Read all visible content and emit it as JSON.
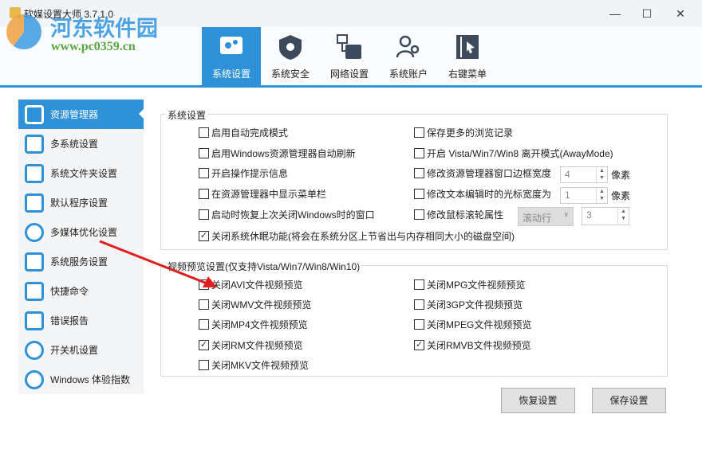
{
  "window": {
    "title": "软媒设置大师 3.7.1.0",
    "minimize": "—",
    "maximize": "☐",
    "close": "✕"
  },
  "watermark": {
    "line1": "河东软件园",
    "line2": "www.pc0359.cn"
  },
  "tabs": [
    {
      "label": "系统设置",
      "icon": "gear-monitor-icon",
      "active": true
    },
    {
      "label": "系统安全",
      "icon": "shield-gear-icon"
    },
    {
      "label": "网络设置",
      "icon": "network-icon"
    },
    {
      "label": "系统账户",
      "icon": "users-icon"
    },
    {
      "label": "右键菜单",
      "icon": "cursor-menu-icon"
    }
  ],
  "sidebar": [
    {
      "label": "资源管理器",
      "active": true
    },
    {
      "label": "多系统设置"
    },
    {
      "label": "系统文件夹设置"
    },
    {
      "label": "默认程序设置"
    },
    {
      "label": "多媒体优化设置"
    },
    {
      "label": "系统服务设置"
    },
    {
      "label": "快捷命令"
    },
    {
      "label": "错误报告"
    },
    {
      "label": "开关机设置"
    },
    {
      "label": "Windows 体验指数"
    }
  ],
  "system": {
    "title": "系统设置",
    "left": [
      {
        "label": "启用自动完成模式",
        "checked": false
      },
      {
        "label": "启用Windows资源管理器自动刷新",
        "checked": false
      },
      {
        "label": "开启操作提示信息",
        "checked": false
      },
      {
        "label": "在资源管理器中显示菜单栏",
        "checked": false
      },
      {
        "label": "启动时恢复上次关闭Windows时的窗口",
        "checked": false
      },
      {
        "label": "关闭系统休眠功能(将会在系统分区上节省出与内存相同大小的磁盘空间)",
        "checked": true
      }
    ],
    "right": [
      {
        "label": "保存更多的浏览记录",
        "checked": false
      },
      {
        "label": "开启 Vista/Win7/Win8 离开模式(AwayMode)",
        "checked": false
      },
      {
        "label": "修改资源管理器窗口边框宽度",
        "checked": false
      },
      {
        "label": "修改文本编辑时的光标宽度为",
        "checked": false
      },
      {
        "label": "修改鼠标滚轮属性",
        "checked": false
      }
    ],
    "border_width": "4",
    "cursor_width": "1",
    "unit": "像素",
    "scroll_mode": "滚动行",
    "scroll_lines": "3"
  },
  "video": {
    "title": "视频预览设置(仅支持Vista/Win7/Win8/Win10)",
    "left": [
      {
        "label": "关闭AVI文件视频预览",
        "checked": false
      },
      {
        "label": "关闭WMV文件视频预览",
        "checked": false
      },
      {
        "label": "关闭MP4文件视频预览",
        "checked": false
      },
      {
        "label": "关闭RM文件视频预览",
        "checked": true
      },
      {
        "label": "关闭MKV文件视频预览",
        "checked": false
      }
    ],
    "right": [
      {
        "label": "关闭MPG文件视频预览",
        "checked": false
      },
      {
        "label": "关闭3GP文件视频预览",
        "checked": false
      },
      {
        "label": "关闭MPEG文件视频预览",
        "checked": false
      },
      {
        "label": "关闭RMVB文件视频预览",
        "checked": true
      }
    ]
  },
  "buttons": {
    "restore": "恢复设置",
    "save": "保存设置"
  },
  "colors": {
    "accent": "#2f92d8",
    "annotation_arrow": "#e02020"
  }
}
